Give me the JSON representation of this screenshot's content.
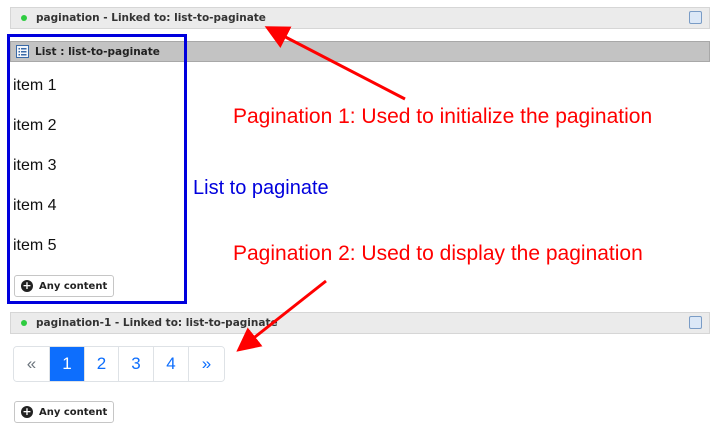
{
  "pagination_bar": {
    "title": "pagination - Linked to: list-to-paginate"
  },
  "list_bar": {
    "title": "List : list-to-paginate"
  },
  "list_items": [
    "item 1",
    "item 2",
    "item 3",
    "item 4",
    "item 5"
  ],
  "any_content_label": "Any content",
  "pagination1_bar": {
    "title": "pagination-1 - Linked to: list-to-paginate"
  },
  "pager": {
    "prev": "«",
    "pages": [
      "1",
      "2",
      "3",
      "4"
    ],
    "active": "1",
    "next": "»"
  },
  "annotations": {
    "pagination1": "Pagination 1: Used to initialize the pagination",
    "list_to_paginate": "List to paginate",
    "pagination2": "Pagination 2: Used to display the pagination"
  },
  "colors": {
    "annotation_red": "#ff0000",
    "annotation_blue": "#0000dd",
    "active_page": "#0d6efd",
    "status_dot": "#2ecc40"
  }
}
